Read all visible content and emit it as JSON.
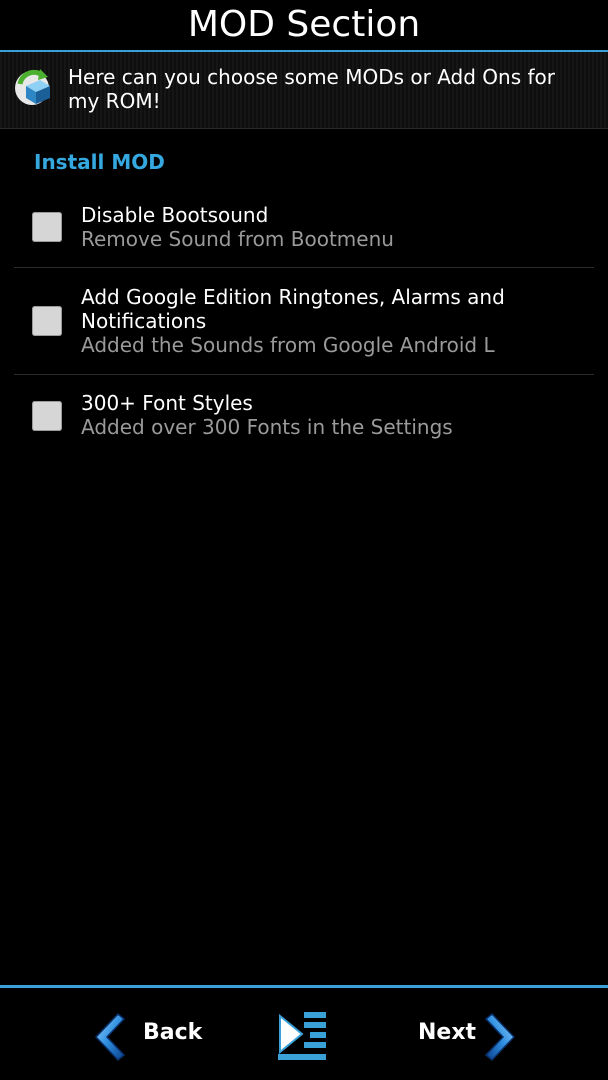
{
  "header": {
    "title": "MOD Section"
  },
  "info": {
    "text": "Here can you choose some MODs or Add Ons for my ROM!",
    "icon": "package-refresh-icon"
  },
  "section": {
    "title": "Install MOD"
  },
  "items": [
    {
      "label": "Disable Bootsound",
      "sub": "Remove Sound from Bootmenu",
      "checked": false
    },
    {
      "label": "Add Google Edition Ringtones, Alarms and Notifications",
      "sub": "Added the Sounds from Google Android L",
      "checked": false
    },
    {
      "label": "300+ Font Styles",
      "sub": "Added over 300 Fonts in the Settings",
      "checked": false
    }
  ],
  "footer": {
    "back_label": "Back",
    "next_label": "Next",
    "menu_icon": "menu-list-icon"
  },
  "colors": {
    "accent": "#35a8e0",
    "background": "#000000",
    "subtext": "#9a9a9a"
  }
}
